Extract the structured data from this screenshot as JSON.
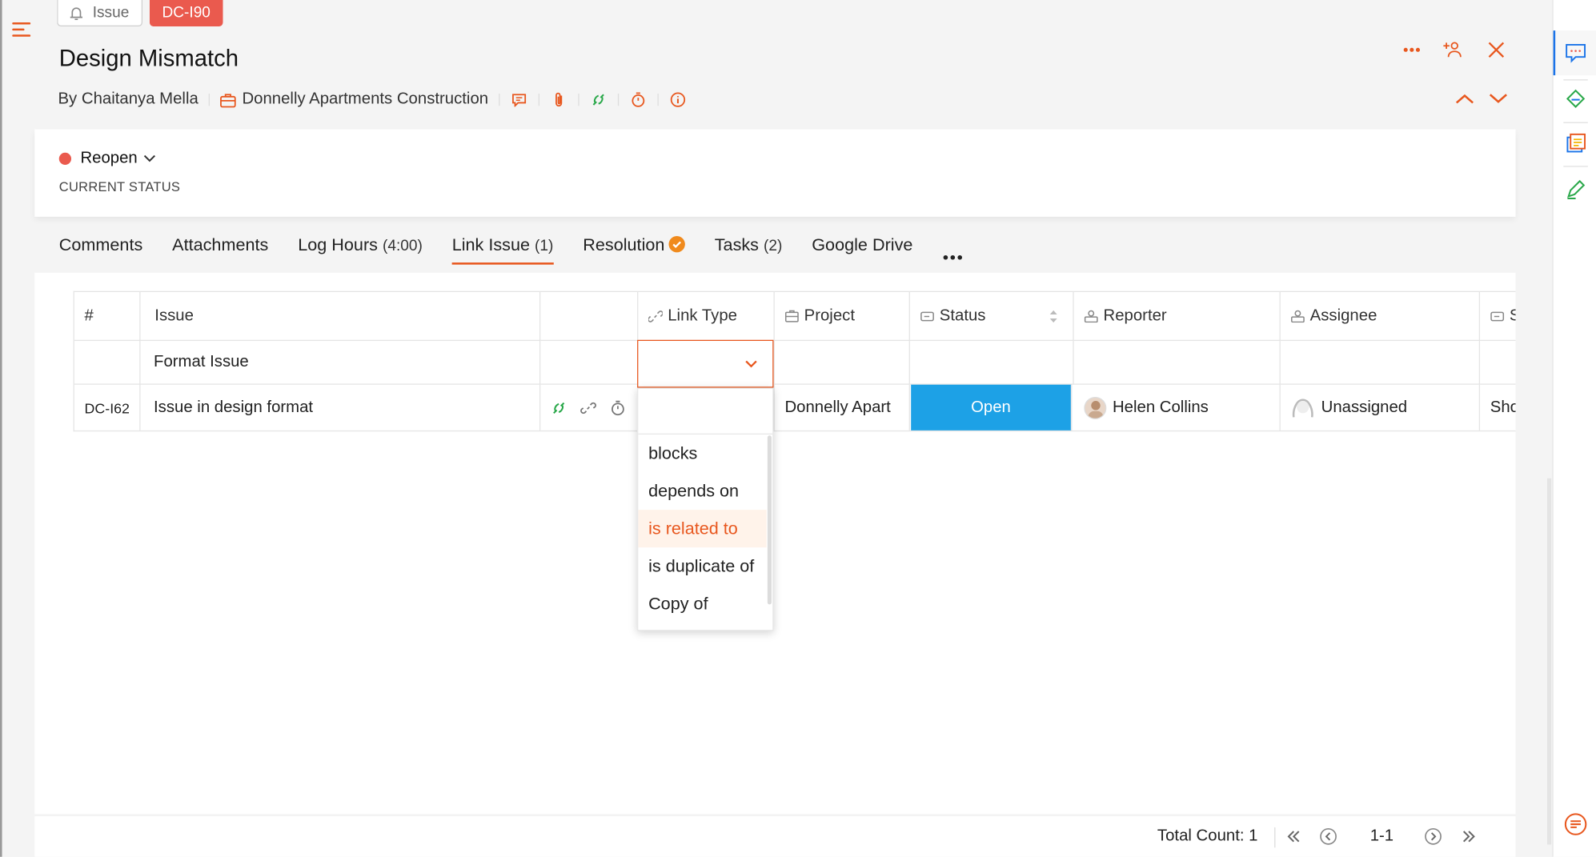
{
  "header": {
    "type_chip": "Issue",
    "id_chip": "DC-I90",
    "title": "Design Mismatch",
    "author": "By Chaitanya Mella",
    "project": "Donnelly Apartments Construction"
  },
  "status": {
    "value": "Reopen",
    "label": "CURRENT STATUS",
    "color": "#ea5a4e"
  },
  "tabs": [
    {
      "label": "Comments",
      "count": ""
    },
    {
      "label": "Attachments",
      "count": ""
    },
    {
      "label": "Log Hours",
      "count": "(4:00)"
    },
    {
      "label": "Link Issue",
      "count": "(1)"
    },
    {
      "label": "Resolution",
      "count": ""
    },
    {
      "label": "Tasks",
      "count": "(2)"
    },
    {
      "label": "Google Drive",
      "count": ""
    }
  ],
  "table": {
    "headers": {
      "num": "#",
      "issue": "Issue",
      "link_type": "Link Type",
      "project": "Project",
      "status": "Status",
      "reporter": "Reporter",
      "assignee": "Assignee",
      "extra": "S"
    },
    "filter_row": {
      "issue": "Format Issue"
    },
    "rows": [
      {
        "id": "DC-I62",
        "issue": "Issue in design format",
        "project": "Donnelly Apart",
        "status": "Open",
        "reporter": "Helen Collins",
        "assignee": "Unassigned",
        "extra": "Sho"
      }
    ]
  },
  "link_type_options": [
    "blocks",
    "depends on",
    "is related to",
    "is duplicate of",
    "Copy of"
  ],
  "footer": {
    "total": "Total Count: 1",
    "range": "1-1"
  },
  "colors": {
    "accent": "#e8571e",
    "status_open": "#1da1e6",
    "id_chip": "#ea5a4e"
  }
}
